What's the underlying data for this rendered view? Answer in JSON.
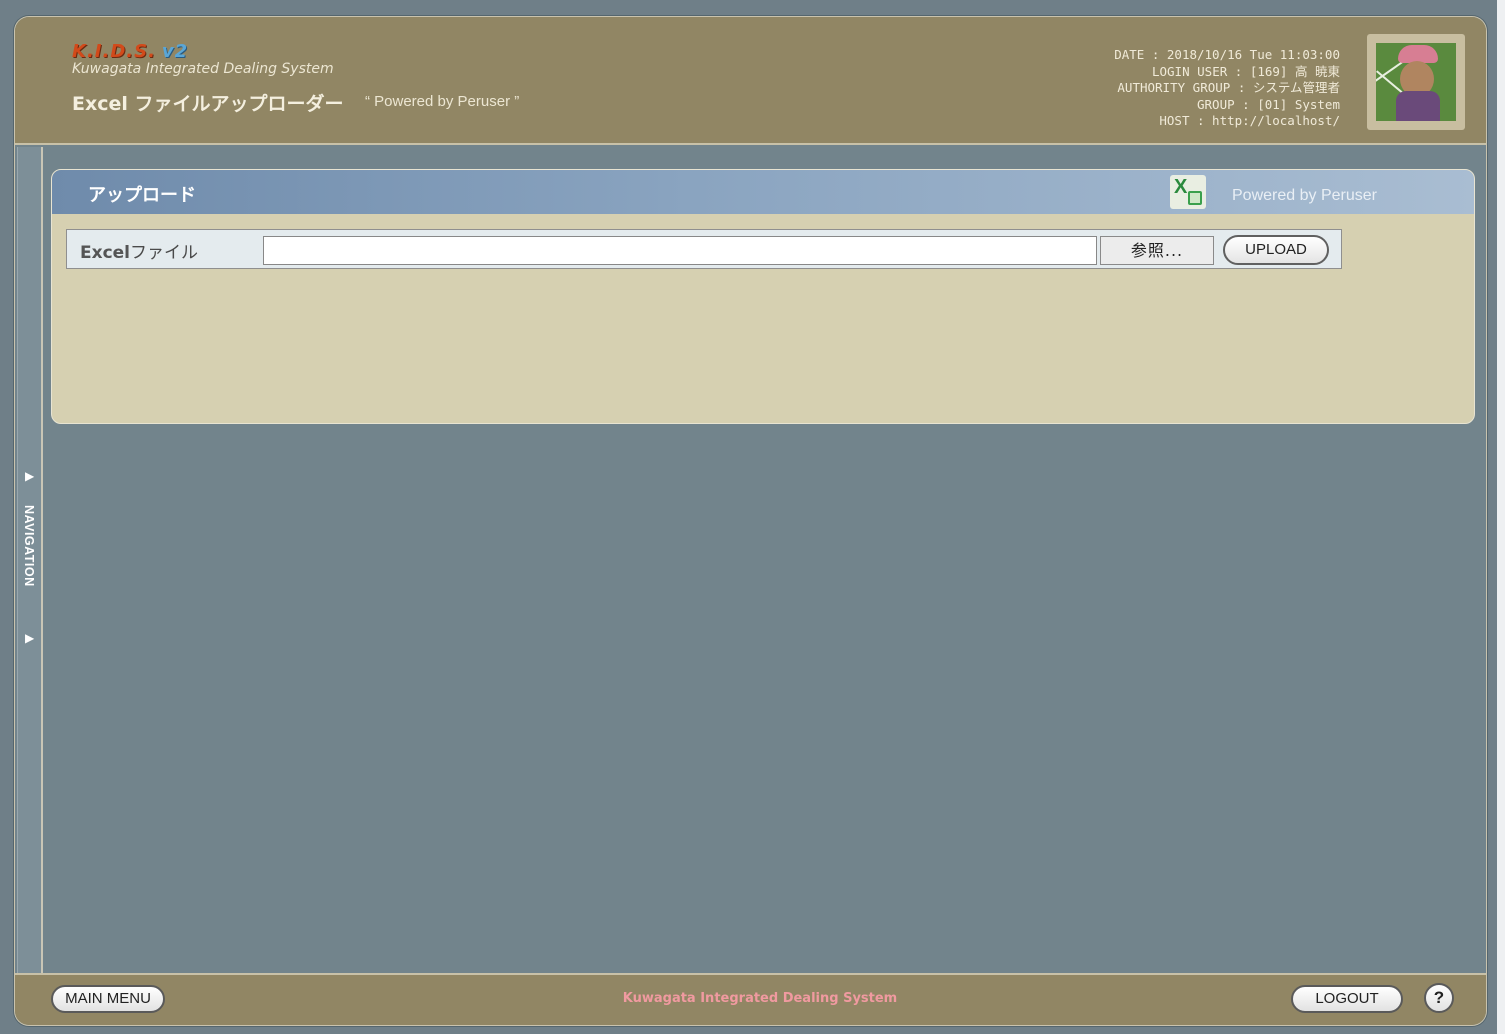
{
  "header": {
    "logo_main": "K.I.D.S.",
    "logo_version": "v2",
    "logo_subtitle": "Kuwagata Integrated Dealing System",
    "page_title": "Excel ファイルアップローダー",
    "powered_by": "“ Powered by Peruser ”",
    "info": {
      "date": "DATE : 2018/10/16 Tue 11:03:00",
      "login_user": "LOGIN USER : [169] 高 暁東",
      "authority_group": "AUTHORITY GROUP : システム管理者",
      "group": "GROUP : [01] System",
      "host": "HOST : http://localhost/"
    }
  },
  "navigation": {
    "label": "NAVIGATION",
    "arrow_top": "▶",
    "arrow_bottom": "▶"
  },
  "panel": {
    "title": "アップロード",
    "powered_by": "Powered by Peruser",
    "excel_icon_glyph": "X",
    "form": {
      "label_bold": "Excel",
      "label_rest": "ファイル",
      "file_value": "",
      "browse_label": "参照...",
      "upload_label": "UPLOAD"
    }
  },
  "footer": {
    "main_menu_label": "MAIN MENU",
    "center_text": "Kuwagata Integrated Dealing System",
    "logout_label": "LOGOUT",
    "help_label": "?"
  },
  "colors": {
    "header_bg": "#918664",
    "panel_bg": "#d6d0b1",
    "page_bg": "#72848c",
    "footer_text": "#f09aa0"
  }
}
